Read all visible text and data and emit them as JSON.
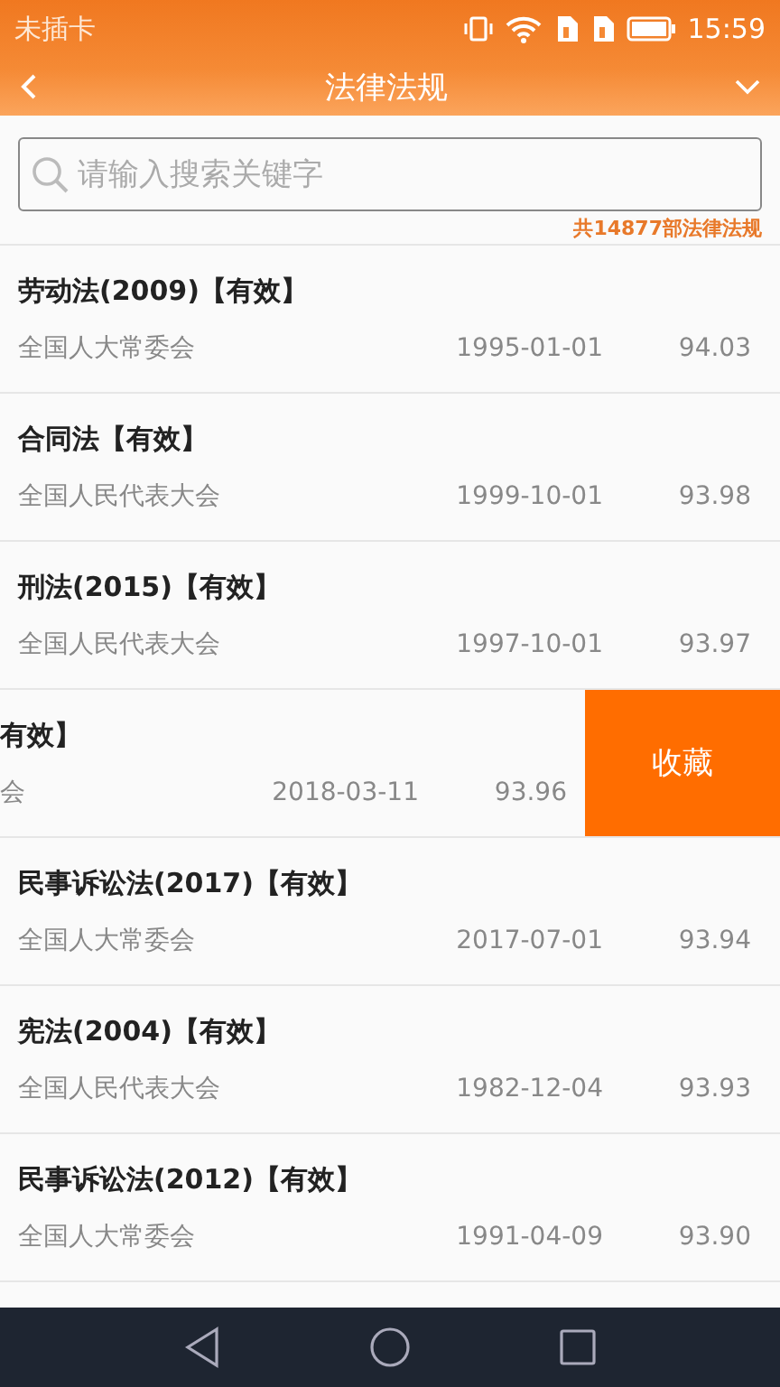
{
  "status_bar": {
    "carrier": "未插卡",
    "time": "15:59"
  },
  "header": {
    "title": "法律法规"
  },
  "search": {
    "placeholder": "请输入搜索关键字"
  },
  "count": "共14877部法律法规",
  "laws": [
    {
      "kind": "normal",
      "title": "劳动法(2009)【有效】",
      "issuer": "全国人大常委会",
      "date": "1995-01-01",
      "score": "94.03"
    },
    {
      "kind": "normal",
      "title": "合同法【有效】",
      "issuer": "全国人民代表大会",
      "date": "1999-10-01",
      "score": "93.98"
    },
    {
      "kind": "normal",
      "title": "刑法(2015)【有效】",
      "issuer": "全国人民代表大会",
      "date": "1997-10-01",
      "score": "93.97"
    },
    {
      "kind": "swiped",
      "title": "有效】",
      "issuer": "会",
      "date": "2018-03-11",
      "score": "93.96",
      "action": "收藏"
    },
    {
      "kind": "normal",
      "title": "民事诉讼法(2017)【有效】",
      "issuer": "全国人大常委会",
      "date": "2017-07-01",
      "score": "93.94"
    },
    {
      "kind": "normal",
      "title": "宪法(2004)【有效】",
      "issuer": "全国人民代表大会",
      "date": "1982-12-04",
      "score": "93.93"
    },
    {
      "kind": "normal",
      "title": "民事诉讼法(2012)【有效】",
      "issuer": "全国人大常委会",
      "date": "1991-04-09",
      "score": "93.90"
    }
  ]
}
